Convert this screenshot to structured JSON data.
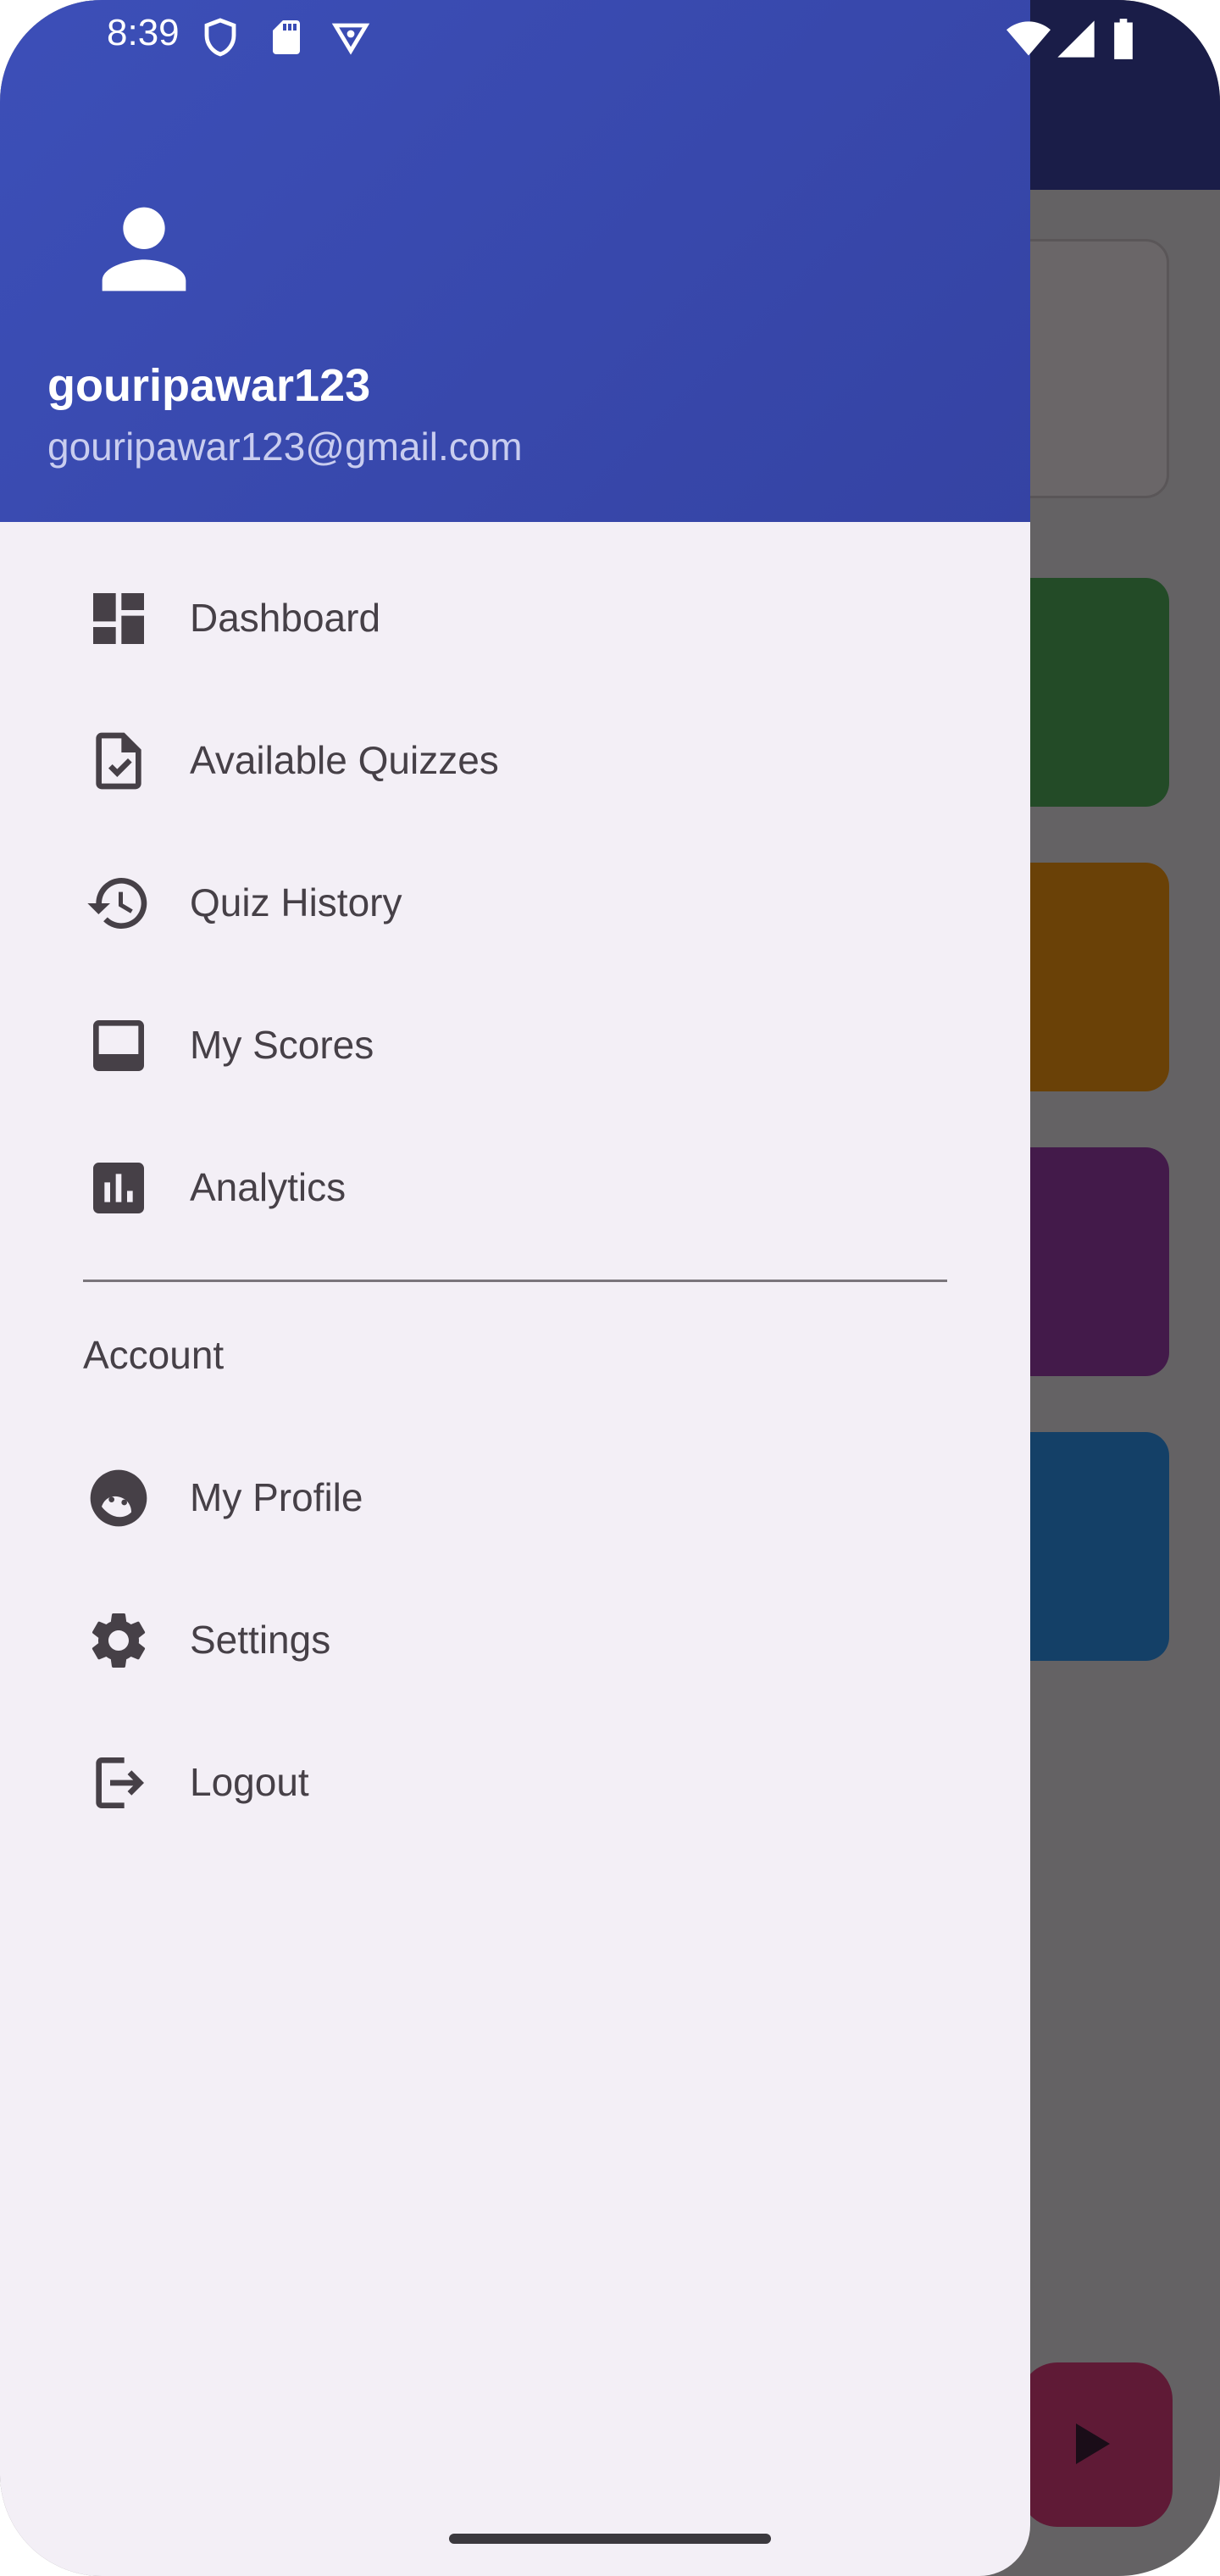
{
  "status_bar": {
    "time": "8:39",
    "left_icons": [
      "shield-icon",
      "sd-card-icon",
      "vpn-icon"
    ],
    "right_icons": [
      "wifi-icon",
      "signal-icon",
      "battery-icon"
    ]
  },
  "drawer": {
    "header": {
      "avatar_icon": "person-icon",
      "username": "gouripawar123",
      "email": "gouripawar123@gmail.com",
      "gradient_colors": [
        "#3c4fb8",
        "#3543a3"
      ]
    },
    "menu_items": [
      {
        "label": "Dashboard",
        "icon": "dashboard-icon"
      },
      {
        "label": "Available Quizzes",
        "icon": "assignment-check-icon"
      },
      {
        "label": "Quiz History",
        "icon": "history-icon"
      },
      {
        "label": "My Scores",
        "icon": "scores-icon"
      },
      {
        "label": "Analytics",
        "icon": "analytics-icon"
      }
    ],
    "section_title": "Account",
    "account_items": [
      {
        "label": "My Profile",
        "icon": "profile-face-icon"
      },
      {
        "label": "Settings",
        "icon": "gear-icon"
      },
      {
        "label": "Logout",
        "icon": "logout-icon"
      }
    ],
    "background": "#f3eff6"
  },
  "background_app": {
    "appbar_color": "#1a1d48",
    "card_colors": [
      "#6a6668",
      "#234b27",
      "#6a4107",
      "#431a4a",
      "#144067"
    ],
    "fab_icon": "play-icon"
  }
}
